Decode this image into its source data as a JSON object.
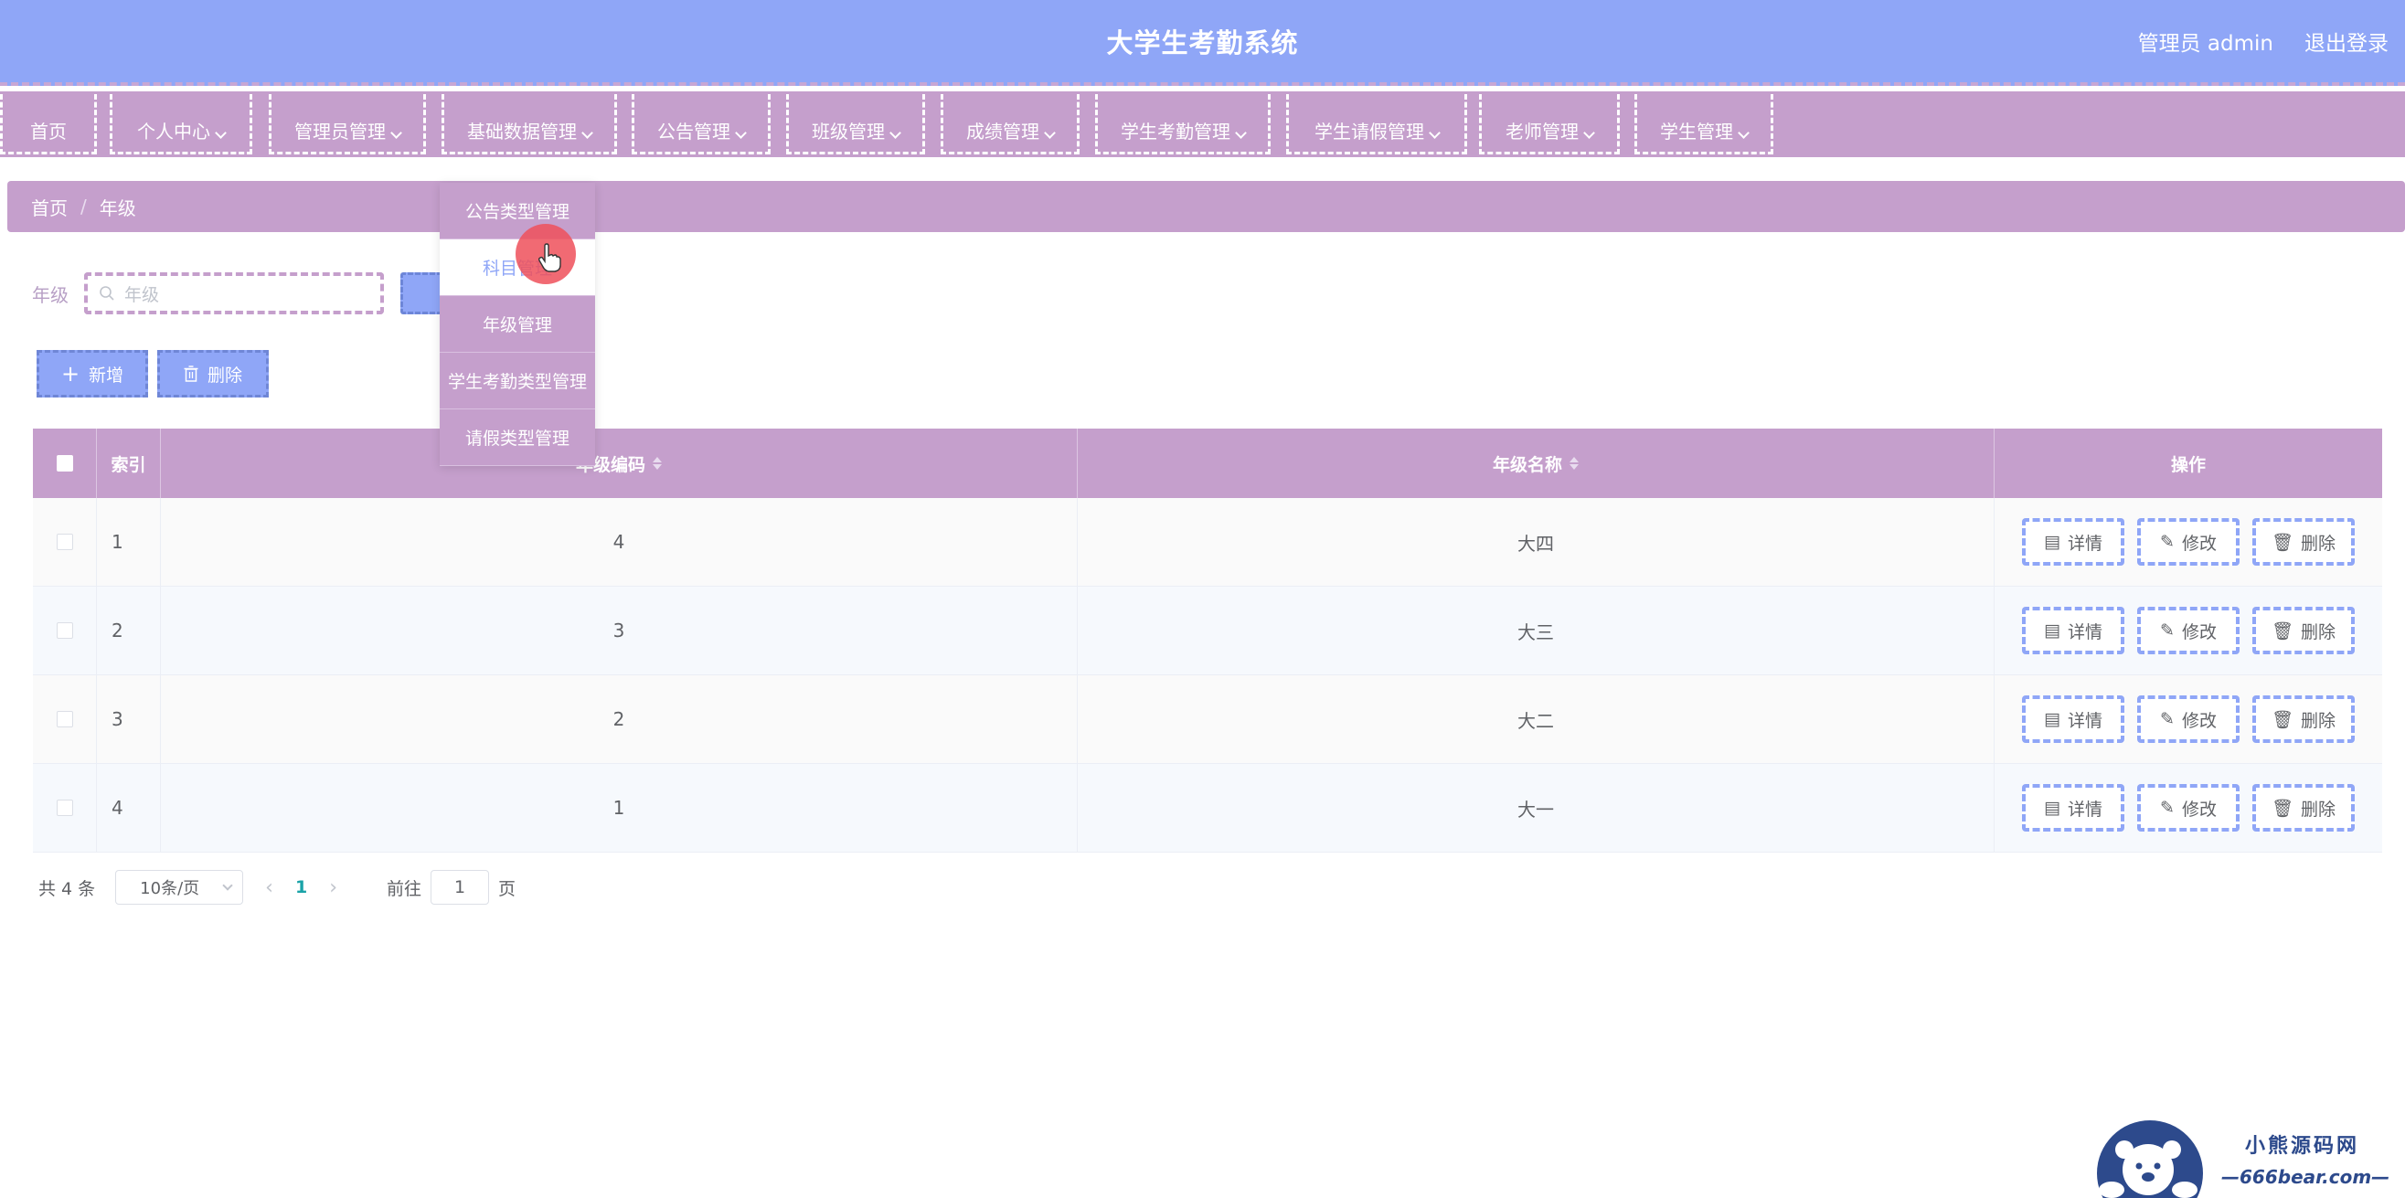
{
  "header": {
    "title": "大学生考勤系统",
    "user_label": "管理员 admin",
    "logout_label": "退出登录"
  },
  "nav": {
    "items": [
      {
        "label": "首页"
      },
      {
        "label": "个人中心"
      },
      {
        "label": "管理员管理"
      },
      {
        "label": "基础数据管理"
      },
      {
        "label": "公告管理"
      },
      {
        "label": "班级管理"
      },
      {
        "label": "成绩管理"
      },
      {
        "label": "学生考勤管理"
      },
      {
        "label": "学生请假管理"
      },
      {
        "label": "老师管理"
      },
      {
        "label": "学生管理"
      }
    ]
  },
  "dropdown": {
    "items": [
      {
        "label": "公告类型管理"
      },
      {
        "label": "科目管理"
      },
      {
        "label": "年级管理"
      },
      {
        "label": "学生考勤类型管理"
      },
      {
        "label": "请假类型管理"
      }
    ],
    "hovered": "科目管理"
  },
  "breadcrumb": {
    "home": "首页",
    "separator": "/",
    "current": "年级"
  },
  "search": {
    "label": "年级",
    "placeholder": "年级"
  },
  "actions": {
    "add_label": "新增",
    "delete_label": "删除"
  },
  "table": {
    "headers": {
      "index": "索引",
      "code": "年级编码",
      "name": "年级名称",
      "operation": "操作"
    },
    "rows": [
      {
        "index": "1",
        "code": "4",
        "name": "大四"
      },
      {
        "index": "2",
        "code": "3",
        "name": "大三"
      },
      {
        "index": "3",
        "code": "2",
        "name": "大二"
      },
      {
        "index": "4",
        "code": "1",
        "name": "大一"
      }
    ],
    "row_buttons": {
      "detail": "详情",
      "edit": "修改",
      "delete": "删除"
    }
  },
  "pagination": {
    "total": "共 4 条",
    "page_size": "10条/页",
    "current_page": "1",
    "goto_prefix": "前往",
    "goto_value": "1",
    "goto_suffix": "页"
  },
  "watermark": {
    "line1": "小熊源码网",
    "line2": "—666bear.com—"
  },
  "colors": {
    "header_bg": "#8fa6f7",
    "nav_bg": "#c59fcc",
    "accent_blue": "#8fa6f7",
    "pagination_active": "#1aa3a8"
  }
}
